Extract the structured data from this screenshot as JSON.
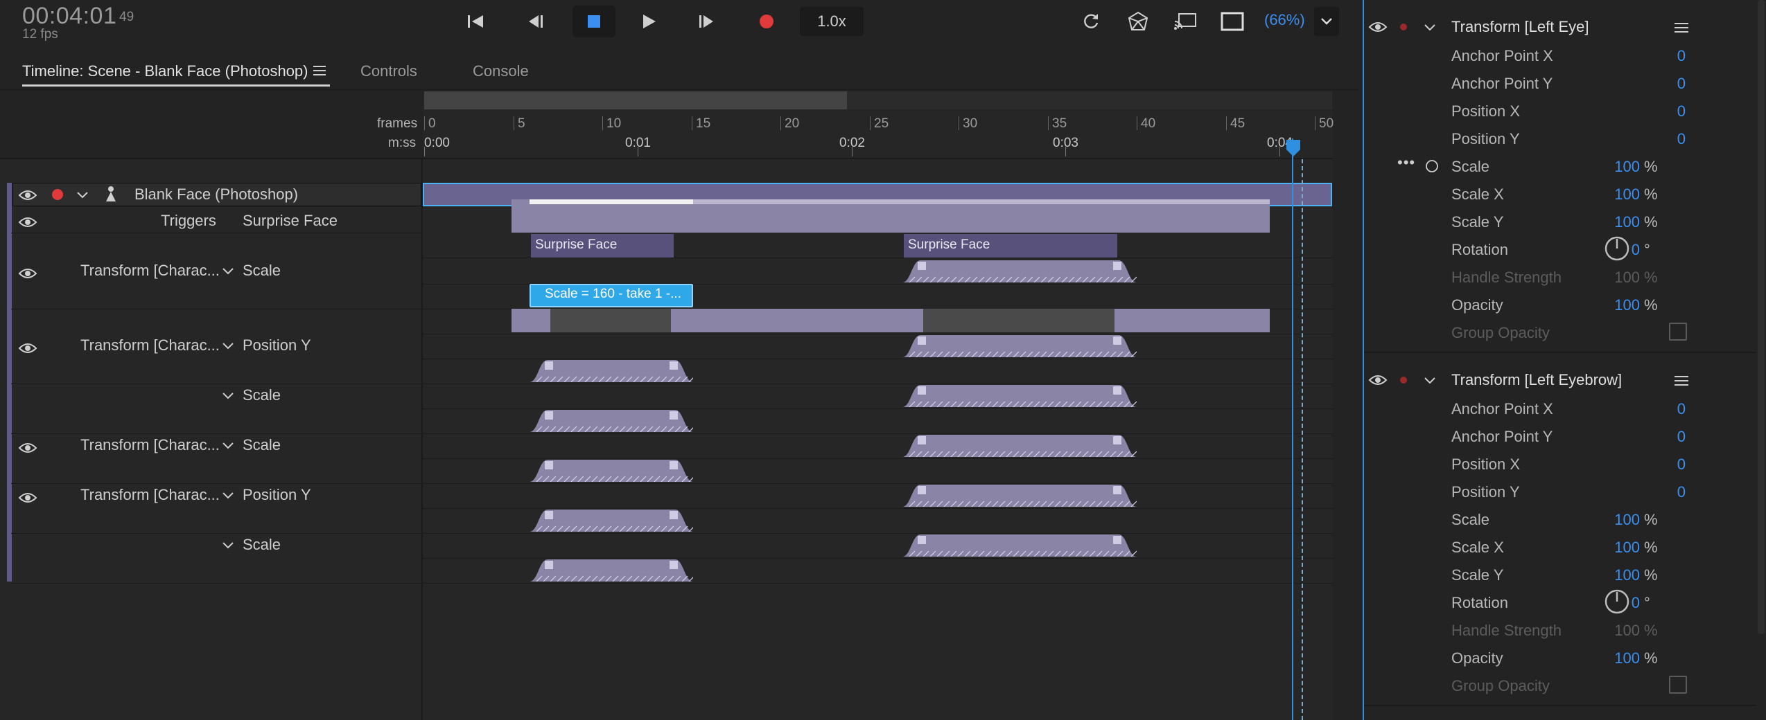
{
  "transport": {
    "timecode": "00:04:01",
    "timecode_frames": "49",
    "fps": "12 fps",
    "speed": "1.0x",
    "zoom": "(66%)"
  },
  "tabs": [
    {
      "label": "Timeline: Scene - Blank Face (Photoshop)",
      "active": true
    },
    {
      "label": "Controls",
      "active": false
    },
    {
      "label": "Console",
      "active": false
    }
  ],
  "ruler": {
    "frames_label": "frames",
    "mss_label": "m:ss",
    "frame_ticks": [
      "0",
      "5",
      "10",
      "15",
      "20",
      "25",
      "30",
      "35",
      "40",
      "45",
      "50"
    ],
    "time_ticks": [
      "0:00",
      "0:01",
      "0:02",
      "0:03",
      "0:04"
    ]
  },
  "tracks": {
    "scene_name": "Blank Face (Photoshop)",
    "triggers_label": "Triggers",
    "triggers_sub": "Surprise Face",
    "rows": [
      {
        "name": "Transform [Charac...",
        "param": "Scale"
      },
      {
        "name": "Transform [Charac...",
        "param": "Position Y"
      },
      {
        "name": "",
        "param": "Scale"
      },
      {
        "name": "Transform [Charac...",
        "param": "Scale"
      },
      {
        "name": "Transform [Charac...",
        "param": "Position Y"
      },
      {
        "name": "",
        "param": "Scale"
      }
    ],
    "trigger_blocks": [
      "Surprise Face",
      "Surprise Face"
    ],
    "take_label": "Scale = 160 - take 1 -..."
  },
  "panel": {
    "sections": [
      {
        "title": "Transform [Left Eye]",
        "props": [
          {
            "label": "Anchor Point X",
            "value": "0",
            "unit": ""
          },
          {
            "label": "Anchor Point Y",
            "value": "0",
            "unit": ""
          },
          {
            "label": "Position X",
            "value": "0",
            "unit": ""
          },
          {
            "label": "Position Y",
            "value": "0",
            "unit": ""
          },
          {
            "label": "Scale",
            "value": "100",
            "unit": "%"
          },
          {
            "label": "Scale X",
            "value": "100",
            "unit": "%"
          },
          {
            "label": "Scale Y",
            "value": "100",
            "unit": "%"
          },
          {
            "label": "Rotation",
            "value": "0",
            "unit": "°"
          },
          {
            "label": "Handle Strength",
            "value": "100",
            "unit": "%"
          },
          {
            "label": "Opacity",
            "value": "100",
            "unit": "%"
          },
          {
            "label": "Group Opacity",
            "value": "",
            "unit": ""
          }
        ]
      },
      {
        "title": "Transform [Left Eyebrow]",
        "props": [
          {
            "label": "Anchor Point X",
            "value": "0",
            "unit": ""
          },
          {
            "label": "Anchor Point Y",
            "value": "0",
            "unit": ""
          },
          {
            "label": "Position X",
            "value": "0",
            "unit": ""
          },
          {
            "label": "Position Y",
            "value": "0",
            "unit": ""
          },
          {
            "label": "Scale",
            "value": "100",
            "unit": "%"
          },
          {
            "label": "Scale X",
            "value": "100",
            "unit": "%"
          },
          {
            "label": "Scale Y",
            "value": "100",
            "unit": "%"
          },
          {
            "label": "Rotation",
            "value": "0",
            "unit": "°"
          },
          {
            "label": "Handle Strength",
            "value": "100",
            "unit": "%"
          },
          {
            "label": "Opacity",
            "value": "100",
            "unit": "%"
          },
          {
            "label": "Group Opacity",
            "value": "",
            "unit": ""
          }
        ]
      }
    ]
  },
  "colors": {
    "accent": "#3b8ff0",
    "record": "#e03a3a",
    "track_bar": "#8a84a6",
    "trigger_block": "#57517c",
    "playhead": "#2f8fe0"
  }
}
